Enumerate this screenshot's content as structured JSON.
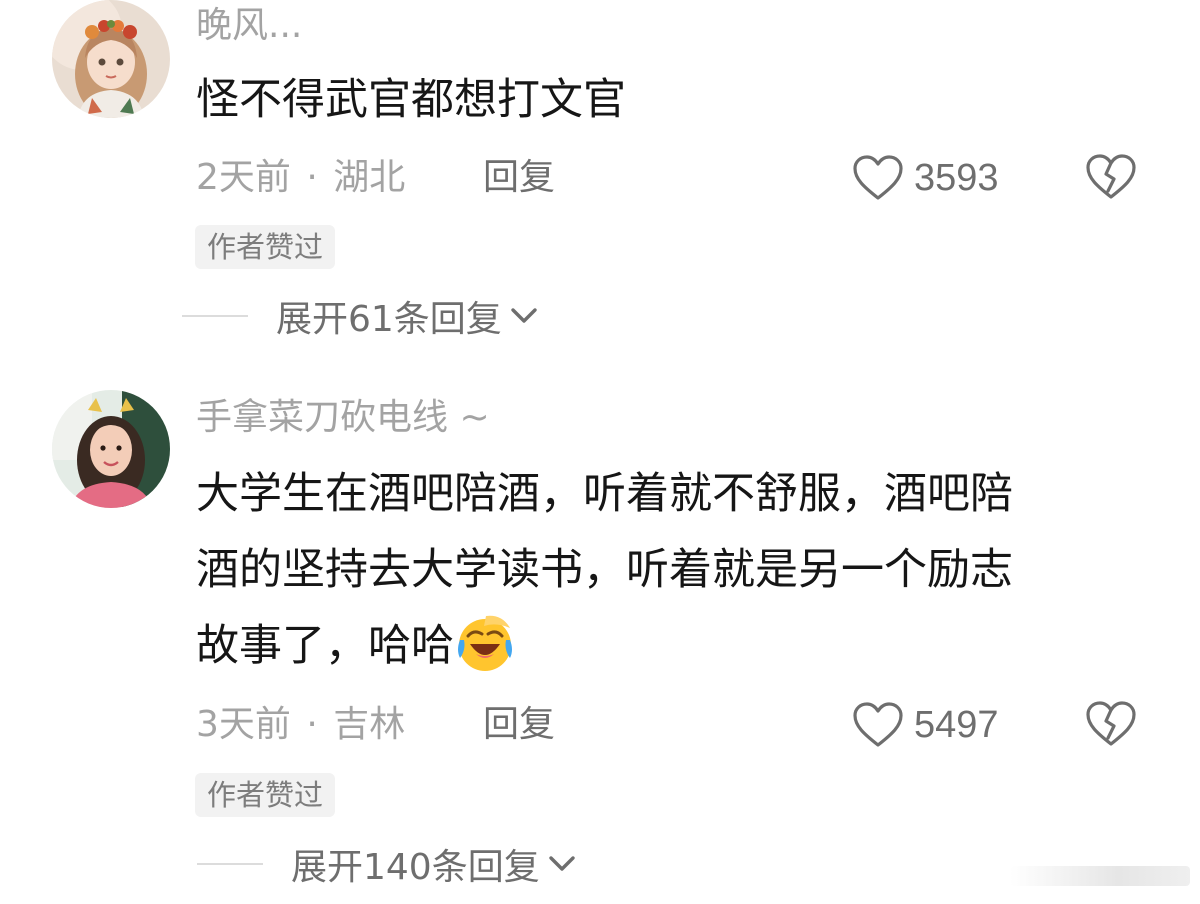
{
  "comments": [
    {
      "username": "晚风...",
      "content": "怪不得武官都想打文官",
      "time": "2天前",
      "separator": "·",
      "location": "湖北",
      "reply_label": "回复",
      "like_count": "3593",
      "badge": "作者赞过",
      "expand_label": "展开61条回复",
      "avatar_icon": "avatar-girl-flower-crown",
      "like_icon": "heart-outline-icon",
      "dislike_icon": "broken-heart-icon",
      "expand_icon": "chevron-down-icon"
    },
    {
      "username": "手拿菜刀砍电线 ~",
      "content_lines": [
        "大学生在酒吧陪酒，听着就不舒服，酒吧陪",
        "酒的坚持去大学读书，听着就是另一个励志",
        "故事了，哈哈"
      ],
      "content_emoji": "laughing-crying-emoji",
      "time": "3天前",
      "separator": "·",
      "location": "吉林",
      "reply_label": "回复",
      "like_count": "5497",
      "badge": "作者赞过",
      "expand_label": "展开140条回复",
      "avatar_icon": "avatar-girl-cat-ears",
      "like_icon": "heart-outline-icon",
      "dislike_icon": "broken-heart-icon",
      "expand_icon": "chevron-down-icon"
    }
  ],
  "colors": {
    "background": "#ffffff",
    "text_primary": "#161616",
    "text_secondary": "#a3a3a3",
    "text_action": "#6e6e6e",
    "badge_bg": "#f2f2f2"
  }
}
